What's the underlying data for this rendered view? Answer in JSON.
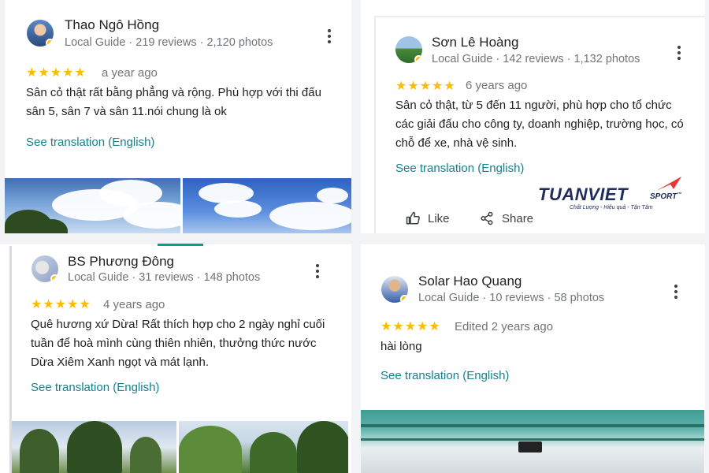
{
  "reviews": [
    {
      "name": "Thao Ngô Hồng",
      "meta": "Local Guide · 219 reviews · 2,120 photos",
      "stars": "★★★★★",
      "when": "a year ago",
      "text": "Sân cỏ thật rất bằng phẳng và rộng. Phù hợp với thi đấu sân 5, sân 7 và sân 11.nói chung là ok",
      "translate": "See translation (English)"
    },
    {
      "name": "Sơn Lê Hoàng",
      "meta": "Local Guide · 142 reviews · 1,132 photos",
      "stars": "★★★★★",
      "when": "6 years ago",
      "text": "Sân cỏ thật, từ 5 đến 11 người, phù hợp cho tổ chức các giải đấu cho công ty, doanh nghiệp, trường học, có chỗ để xe, nhà vệ sinh.",
      "translate": "See translation (English)",
      "like": "Like",
      "share": "Share"
    },
    {
      "name": "BS Phương Đông",
      "meta": "Local Guide · 31 reviews · 148 photos",
      "stars": "★★★★★",
      "when": "4 years ago",
      "text": "Quê hương xứ Dừa! Rất thích hợp cho 2 ngày nghỉ cuối tuần để hoà mình cùng thiên nhiên, thưởng thức nước Dừa Xiêm Xanh ngọt và mát lạnh.",
      "translate": "See translation (English)"
    },
    {
      "name": "Solar Hao Quang",
      "meta": "Local Guide · 10 reviews · 58 photos",
      "stars": "★★★★★",
      "when": "Edited 2 years ago",
      "text": "hài lòng",
      "translate": "See translation (English)"
    }
  ],
  "logo": {
    "main": "TUANVIET",
    "sport": "SPORT",
    "tm": "™",
    "tagline": "Chất Lượng - Hiệu quả - Tận Tâm"
  },
  "icons": [
    "kebab-menu-icon",
    "like-icon",
    "share-icon",
    "local-guide-badge-icon"
  ],
  "colors": {
    "star": "#fbbc04",
    "link": "#15818f",
    "meta": "#70757a",
    "logo": "#1f2c5c",
    "logo_accent": "#e53935"
  }
}
